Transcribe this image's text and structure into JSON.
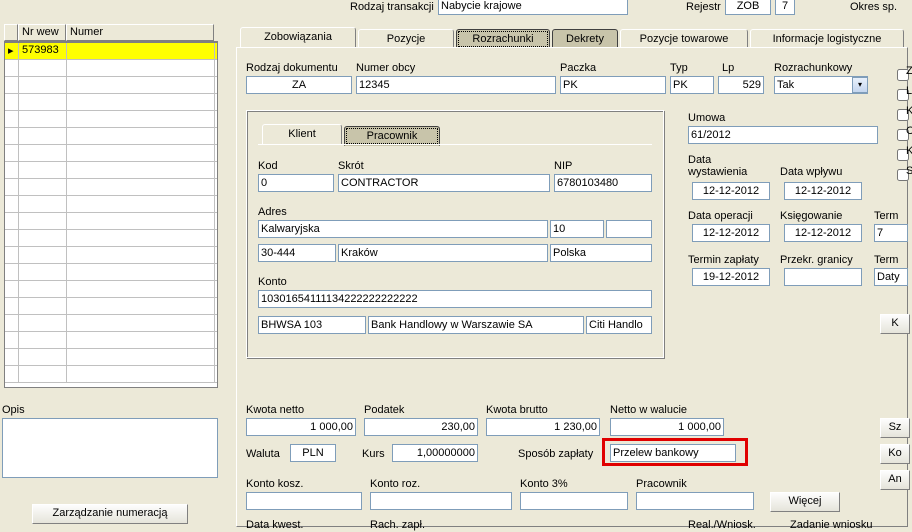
{
  "top": {
    "rodzaj_transakcji_lbl": "Rodzaj transakcji",
    "rodzaj_transakcji_val": "Nabycie krajowe",
    "rejestr_lbl": "Rejestr",
    "rejestr_val": "ZOB",
    "rejestr_num": "7",
    "okres_lbl": "Okres sp."
  },
  "leftgrid": {
    "col1": "Nr wew",
    "col2": "Numer",
    "rows": [
      "573983",
      "",
      "",
      "",
      "",
      "",
      "",
      "",
      "",
      "",
      "",
      "",
      "",
      "",
      "",
      "",
      "",
      "",
      "",
      ""
    ]
  },
  "opis_lbl": "Opis",
  "btn_zarz": "Zarządzanie numeracją",
  "tabs": [
    "Zobowiązania",
    "Pozycje",
    "Rozrachunki",
    "Dekrety",
    "Pozycje towarowe",
    "Informacje logistyczne"
  ],
  "doc": {
    "rodzaj_lbl": "Rodzaj dokumentu",
    "rodzaj_val": "ZA",
    "numer_lbl": "Numer obcy",
    "numer_val": "12345",
    "paczka_lbl": "Paczka",
    "paczka_val": "PK",
    "typ_lbl": "Typ",
    "typ_val": "PK",
    "lp_lbl": "Lp",
    "lp_val": "529",
    "rozr_lbl": "Rozrachunkowy",
    "rozr_val": "Tak"
  },
  "klient_tab": "Klient",
  "pracownik_tab": "Pracownik",
  "client": {
    "kod_lbl": "Kod",
    "kod_val": "0",
    "skrot_lbl": "Skrót",
    "skrot_val": "CONTRACTOR",
    "nip_lbl": "NIP",
    "nip_val": "6780103480",
    "adres_lbl": "Adres",
    "ulica": "Kalwaryjska",
    "nr": "10",
    "nr2": "",
    "kod_poczt": "30-444",
    "miasto": "Kraków",
    "kraj": "Polska",
    "konto_lbl": "Konto",
    "konto_val": "10301654111134222222222222",
    "bank_kod": "BHWSA 103",
    "bank_nazwa": "Bank Handlowy w Warszawie SA",
    "bank_ext": "Citi Handlo"
  },
  "right": {
    "umowa_lbl": "Umowa",
    "umowa_val": "61/2012",
    "data_wyst_lbl": "Data wystawienia",
    "data_wyst_val": "12-12-2012",
    "data_wpl_lbl": "Data wpływu",
    "data_wpl_val": "12-12-2012",
    "data_op_lbl": "Data operacji",
    "data_op_val": "12-12-2012",
    "ksieg_lbl": "Księgowanie",
    "ksieg_val": "12-12-2012",
    "term_lbl": "Term",
    "term_val": "7",
    "termin_lbl": "Termin zapłaty",
    "termin_val": "19-12-2012",
    "przekr_lbl": "Przekr. granicy",
    "term2_lbl": "Term",
    "daty_val": "Daty",
    "btn_k": "K"
  },
  "amounts": {
    "netto_lbl": "Kwota netto",
    "netto_val": "1 000,00",
    "podatek_lbl": "Podatek",
    "podatek_val": "230,00",
    "brutto_lbl": "Kwota brutto",
    "brutto_val": "1 230,00",
    "netto_wal_lbl": "Netto w walucie",
    "netto_wal_val": "1 000,00",
    "waluta_lbl": "Waluta",
    "waluta_val": "PLN",
    "kurs_lbl": "Kurs",
    "kurs_val": "1,00000000",
    "sposob_lbl": "Sposób zapłaty",
    "sposob_val": "Przelew bankowy"
  },
  "bottom": {
    "konto_kosz_lbl": "Konto kosz.",
    "konto_roz_lbl": "Konto roz.",
    "konto3_lbl": "Konto 3%",
    "prac_lbl": "Pracownik",
    "wiecej": "Więcej",
    "data_kwest": "Data  kwest.",
    "rach_zapl": "Rach. zapł.",
    "real_wn": "Real./Wniosk.",
    "zad_wn": "Zadanie wniosku"
  },
  "side_btns": {
    "sz": "Sz",
    "ko": "Ko",
    "an": "An"
  }
}
